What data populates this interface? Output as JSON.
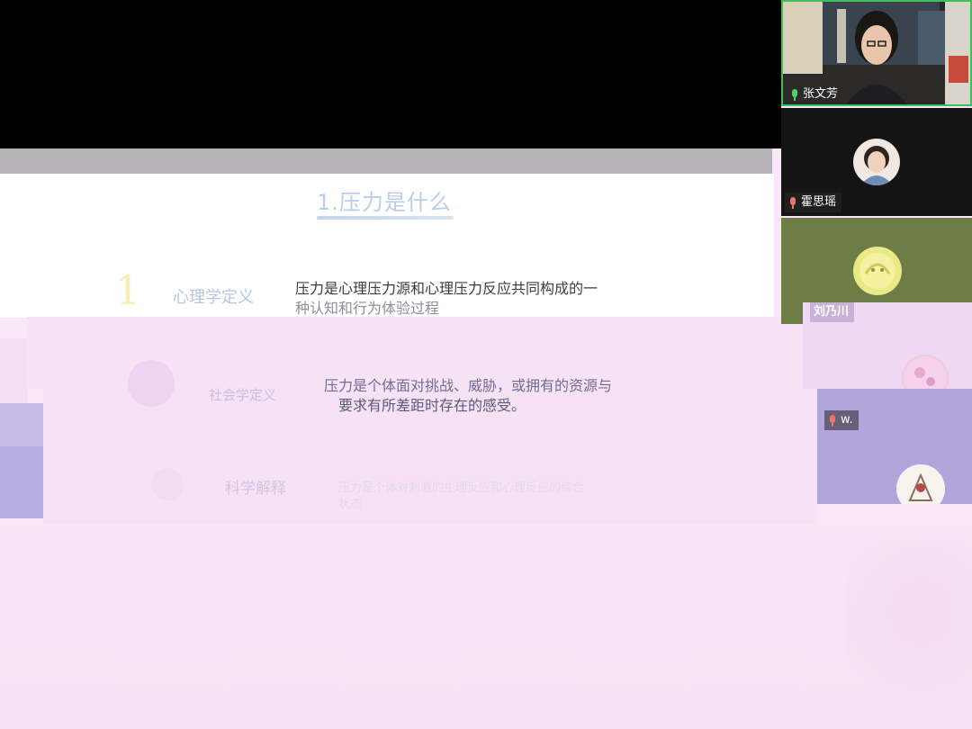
{
  "slide": {
    "title": "1.压力是什么",
    "number": "1",
    "rows": [
      {
        "term": "心理学定义",
        "definition_line1": "压力是心理压力源和心理压力反应共同构成的一",
        "definition_line2": "种认知和行为体验过程"
      },
      {
        "term": "社会学定义",
        "definition_line1": "压力是个体面对挑战、威胁，或拥有的资源与",
        "definition_line2": "要求有所差距时存在的感受。"
      },
      {
        "term": "科学解释",
        "definition_line1": "压力是个体对刺激的生理反应和心理反应的综合",
        "definition_line2": "状态"
      }
    ]
  },
  "participants": [
    {
      "name": "张文芳",
      "mic": "on",
      "active": true
    },
    {
      "name": "霍思瑶",
      "mic": "off",
      "active": false
    },
    {
      "name": "刘乃川",
      "mic": "off",
      "active": false
    },
    {
      "name": "w.",
      "mic": "off",
      "active": false
    }
  ],
  "colors": {
    "active_speaker_border": "#3fbf5a",
    "mic_on": "#4fd16b",
    "mic_off": "#f07171"
  }
}
